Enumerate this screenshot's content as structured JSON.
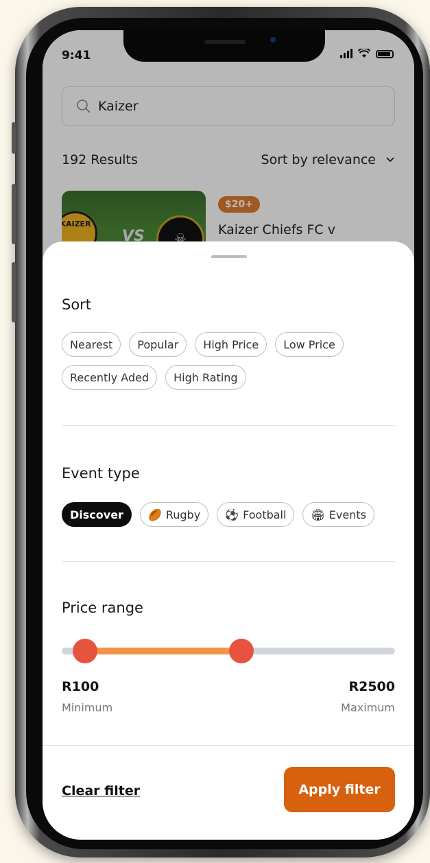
{
  "status_bar": {
    "time": "9:41"
  },
  "search": {
    "value": "Kaizer",
    "icon": "search-icon"
  },
  "results": {
    "count_label": "192 Results",
    "sort_label": "Sort by relevance"
  },
  "event_card": {
    "price_badge": "$20+",
    "title": "Kaizer Chiefs FC v",
    "team_a": "KAIZER",
    "vs_text": "VS",
    "team_b_icon": "skull-icon"
  },
  "sort": {
    "title": "Sort",
    "options": [
      "Nearest",
      "Popular",
      "High Price",
      "Low Price",
      "Recently Aded",
      "High Rating"
    ]
  },
  "event_type": {
    "title": "Event type",
    "options": [
      {
        "label": "Discover",
        "selected": true
      },
      {
        "label": "Rugby",
        "icon": "rugby-ball-icon",
        "glyph": "🏉"
      },
      {
        "label": "Football",
        "icon": "soccer-ball-icon",
        "glyph": "⚽"
      },
      {
        "label": "Events",
        "icon": "stadium-icon",
        "glyph": "🏟"
      }
    ]
  },
  "price_range": {
    "title": "Price range",
    "min_value": "R100",
    "min_label": "Minimum",
    "max_value": "R2500",
    "max_label": "Maximum",
    "low_fraction": 0.07,
    "high_fraction": 0.54
  },
  "footer": {
    "clear_label": "Clear filter",
    "apply_label": "Apply filter"
  },
  "colors": {
    "accent": "#d7610f",
    "slider_fill": "#f39346",
    "slider_thumb": "#e6533e",
    "price_badge": "#e07a2e",
    "selected_chip": "#0d0d0d"
  }
}
